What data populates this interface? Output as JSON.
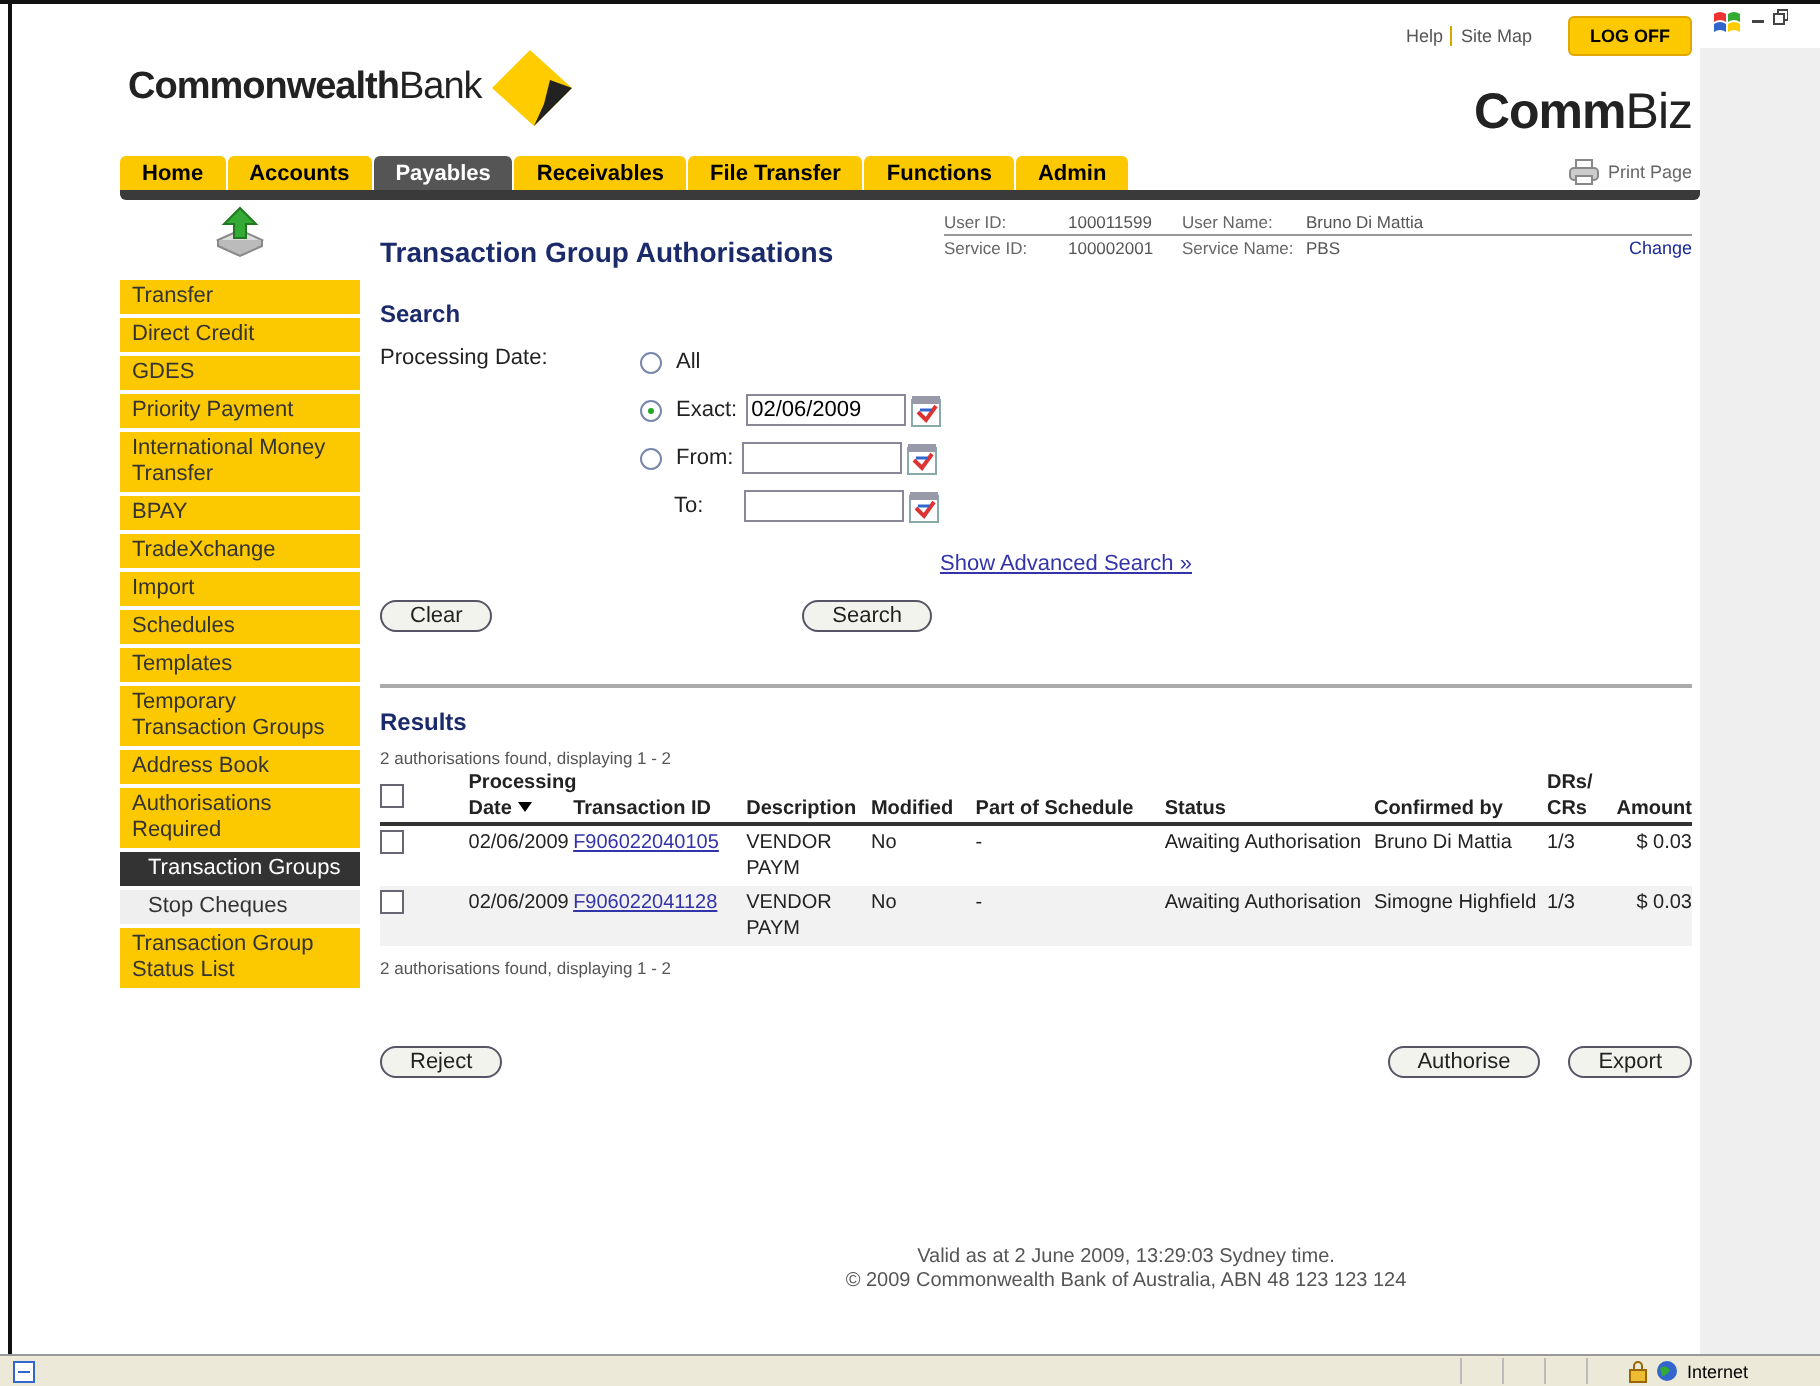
{
  "header": {
    "logo_bold": "Commonwealth",
    "logo_light": "Bank",
    "links": [
      "Help",
      "Site Map"
    ],
    "logoff": "LOG OFF",
    "brand_bold": "Comm",
    "brand_light": "Biz",
    "print": "Print Page"
  },
  "tabs": [
    {
      "label": "Home",
      "selected": false
    },
    {
      "label": "Accounts",
      "selected": false
    },
    {
      "label": "Payables",
      "selected": true
    },
    {
      "label": "Receivables",
      "selected": false
    },
    {
      "label": "File Transfer",
      "selected": false
    },
    {
      "label": "Functions",
      "selected": false
    },
    {
      "label": "Admin",
      "selected": false
    }
  ],
  "page_title": "Transaction Group Authorisations",
  "user_info": {
    "fields": [
      {
        "label": "User ID:",
        "value": "100011599"
      },
      {
        "label": "User Name:",
        "value": "Bruno Di Mattia"
      },
      {
        "label": "Service ID:",
        "value": "100002001"
      },
      {
        "label": "Service Name:",
        "value": "PBS"
      }
    ],
    "change": "Change"
  },
  "sidebar": {
    "items": [
      {
        "label": "Transfer",
        "kind": "item",
        "selected": false
      },
      {
        "label": "Direct Credit",
        "kind": "item",
        "selected": false
      },
      {
        "label": "GDES",
        "kind": "item",
        "selected": false
      },
      {
        "label": "Priority Payment",
        "kind": "item",
        "selected": false
      },
      {
        "label": "International Money Transfer",
        "kind": "item",
        "selected": false
      },
      {
        "label": "BPAY",
        "kind": "item",
        "selected": false
      },
      {
        "label": "TradeXchange",
        "kind": "item",
        "selected": false
      },
      {
        "label": "Import",
        "kind": "item",
        "selected": false
      },
      {
        "label": "Schedules",
        "kind": "item",
        "selected": false
      },
      {
        "label": "Templates",
        "kind": "item",
        "selected": false
      },
      {
        "label": "Temporary Transaction Groups",
        "kind": "item",
        "selected": false
      },
      {
        "label": "Address Book",
        "kind": "item",
        "selected": false
      },
      {
        "label": "Authorisations Required",
        "kind": "item",
        "selected": false
      },
      {
        "label": "Transaction Groups",
        "kind": "subitem",
        "selected": true
      },
      {
        "label": "Stop Cheques",
        "kind": "subitem",
        "selected": false
      },
      {
        "label": "Transaction Group Status List",
        "kind": "item",
        "selected": false
      }
    ]
  },
  "search": {
    "title": "Search",
    "date_label": "Processing Date:",
    "options": [
      {
        "label": "All",
        "selected": false,
        "kind": "plain"
      },
      {
        "label": "Exact:",
        "selected": true,
        "kind": "date",
        "value": "02/06/2009"
      },
      {
        "label": "From:",
        "selected": false,
        "kind": "date"
      }
    ],
    "to_label": "To:",
    "advanced": "Show Advanced Search »",
    "clear": "Clear",
    "submit": "Search"
  },
  "results": {
    "title": "Results",
    "summary_top": "2 authorisations found, displaying 1 - 2",
    "summary_bottom": "2 authorisations found, displaying 1 - 2",
    "select_all_checked": false,
    "columns": [
      {
        "label": "Processing Date",
        "sorted": true
      },
      {
        "label": "Transaction ID",
        "sorted": false
      },
      {
        "label": "Description",
        "sorted": false
      },
      {
        "label": "Modified",
        "sorted": false
      },
      {
        "label": "Part of Schedule",
        "sorted": false
      },
      {
        "label": "Status",
        "sorted": false
      },
      {
        "label": "Confirmed by",
        "sorted": false
      },
      {
        "label": "DRs/ CRs",
        "sorted": false
      },
      {
        "label": "Amount",
        "sorted": false
      }
    ],
    "rows": [
      {
        "checked": false,
        "cells": [
          "02/06/2009",
          "F906022040105",
          "VENDOR PAYM",
          "No",
          "-",
          "Awaiting Authorisation",
          "Bruno Di Mattia",
          "1/3",
          "$ 0.03"
        ]
      },
      {
        "checked": false,
        "cells": [
          "02/06/2009",
          "F906022041128",
          "VENDOR PAYM",
          "No",
          "-",
          "Awaiting Authorisation",
          "Simogne Highfield",
          "1/3",
          "$ 0.03"
        ]
      }
    ]
  },
  "actions": {
    "reject": "Reject",
    "authorise": "Authorise",
    "export": "Export"
  },
  "footer": [
    "Valid as at 2 June 2009, 13:29:03 Sydney time.",
    "© 2009 Commonwealth Bank of Australia, ABN 48 123 123 124"
  ],
  "status_bar": {
    "zone": "Internet"
  }
}
